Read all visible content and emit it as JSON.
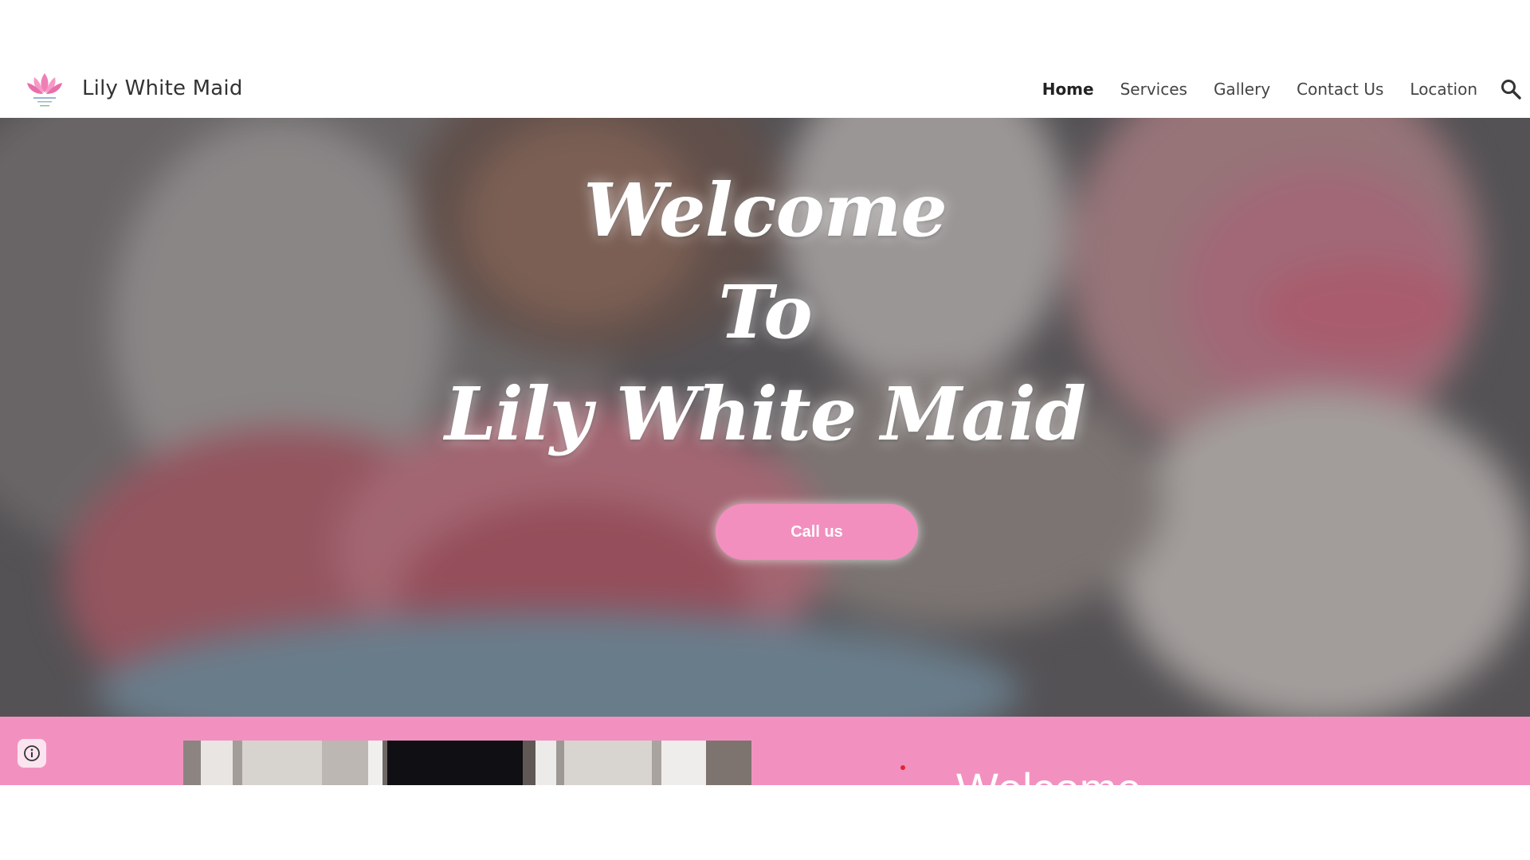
{
  "site": {
    "title": "Lily White Maid"
  },
  "nav": {
    "items": [
      {
        "label": "Home",
        "active": true
      },
      {
        "label": "Services",
        "active": false
      },
      {
        "label": "Gallery",
        "active": false
      },
      {
        "label": "Contact Us",
        "active": false
      },
      {
        "label": "Location",
        "active": false
      }
    ],
    "search_icon": "search-icon"
  },
  "hero": {
    "line1": "Welcome",
    "line2": "To",
    "line3": "Lily White Maid",
    "cta_label": "Call us"
  },
  "band": {
    "welcome_text": "Welcome",
    "info_icon": "info-icon"
  },
  "colors": {
    "brand_pink": "#f291c0",
    "header_text": "#333333",
    "hero_text": "#ffffff"
  }
}
